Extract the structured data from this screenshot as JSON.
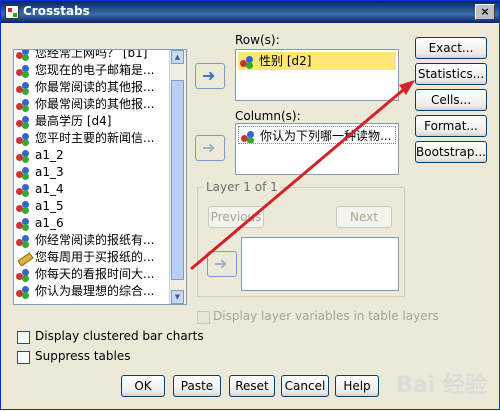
{
  "window": {
    "title": "Crosstabs",
    "close_glyph": "×"
  },
  "variables": {
    "items": [
      {
        "label": "您经常上网吗？ [b1]",
        "icon": "nominal-icon"
      },
      {
        "label": "您现在的电子邮箱是...",
        "icon": "nominal-icon"
      },
      {
        "label": "你最常阅读的其他报...",
        "icon": "nominal-icon"
      },
      {
        "label": "你最常阅读的其他报...",
        "icon": "nominal-icon"
      },
      {
        "label": "最高学历 [d4]",
        "icon": "nominal-icon"
      },
      {
        "label": "您平时主要的新闻信...",
        "icon": "nominal-icon"
      },
      {
        "label": "a1_2",
        "icon": "nominal-icon"
      },
      {
        "label": "a1_3",
        "icon": "nominal-icon"
      },
      {
        "label": "a1_4",
        "icon": "nominal-icon"
      },
      {
        "label": "a1_5",
        "icon": "nominal-icon"
      },
      {
        "label": "a1_6",
        "icon": "nominal-icon"
      },
      {
        "label": "你经常阅读的报纸有...",
        "icon": "nominal-icon"
      },
      {
        "label": "您每周用于买报纸的...",
        "icon": "scale-icon"
      },
      {
        "label": "你每天的看报时间大...",
        "icon": "nominal-icon"
      },
      {
        "label": "你认为最理想的综合...",
        "icon": "nominal-icon"
      }
    ]
  },
  "rows": {
    "label": "Row(s):",
    "items": [
      "性别 [d2]"
    ]
  },
  "columns": {
    "label": "Column(s):",
    "items": [
      "你认为下列哪一种读物..."
    ]
  },
  "layer": {
    "title": "Layer 1 of 1",
    "previous": "Previous",
    "next": "Next"
  },
  "side_buttons": {
    "exact": "Exact...",
    "statistics": "Statistics...",
    "cells": "Cells...",
    "format": "Format...",
    "bootstrap": "Bootstrap..."
  },
  "display_layer_vars": "Display layer variables in table layers",
  "options": {
    "clustered": "Display clustered bar charts",
    "suppress": "Suppress tables"
  },
  "bottom_buttons": {
    "ok": "OK",
    "paste": "Paste",
    "reset": "Reset",
    "cancel": "Cancel",
    "help": "Help"
  },
  "watermark": "Bai 经验",
  "accent": {
    "annotation_arrow": "#d6202a",
    "selection": "#ffe67a",
    "title": "#0a246a"
  }
}
